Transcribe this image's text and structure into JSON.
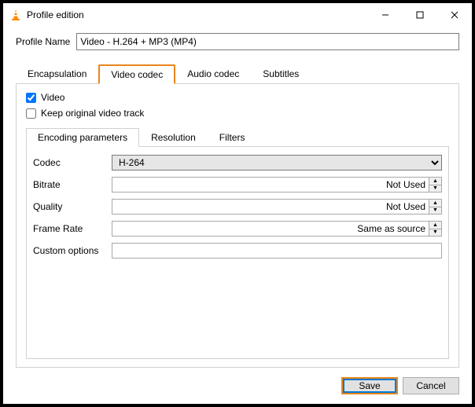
{
  "window": {
    "title": "Profile edition"
  },
  "profile": {
    "label": "Profile Name",
    "value": "Video - H.264 + MP3 (MP4)"
  },
  "tabs": {
    "encapsulation": "Encapsulation",
    "video_codec": "Video codec",
    "audio_codec": "Audio codec",
    "subtitles": "Subtitles"
  },
  "video_panel": {
    "video_chk": "Video",
    "keep_chk": "Keep original video track",
    "subtabs": {
      "encoding": "Encoding parameters",
      "resolution": "Resolution",
      "filters": "Filters"
    },
    "codec": {
      "label": "Codec",
      "value": "H-264"
    },
    "bitrate": {
      "label": "Bitrate",
      "value": "Not Used"
    },
    "quality": {
      "label": "Quality",
      "value": "Not Used"
    },
    "framerate": {
      "label": "Frame Rate",
      "value": "Same as source"
    },
    "custom": {
      "label": "Custom options",
      "value": ""
    }
  },
  "footer": {
    "save": "Save",
    "cancel": "Cancel"
  }
}
